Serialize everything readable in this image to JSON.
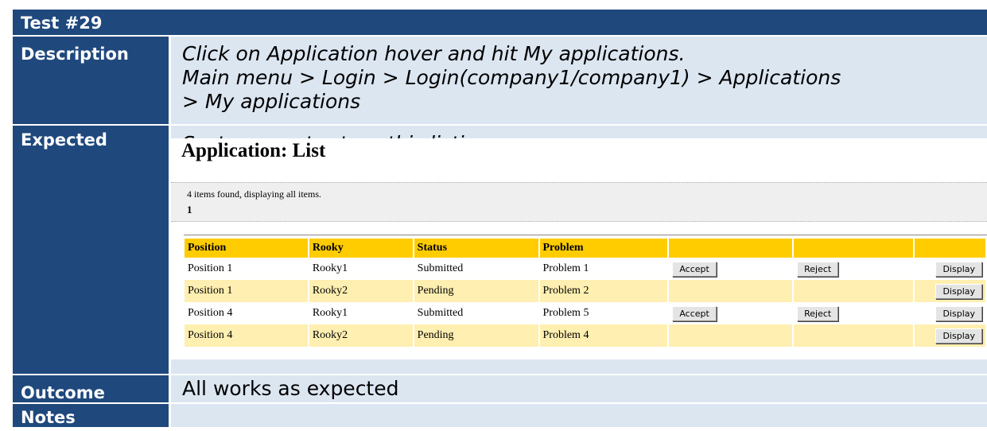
{
  "header": {
    "title": "Test #29"
  },
  "rows": {
    "description": {
      "label": "Description",
      "line1": "Click on Application hover and hit My applications.",
      "line2": "Main menu > Login > Login(company1/company1) > Applications",
      "line3": "> My applications"
    },
    "expected": {
      "label": "Expected",
      "text": "System must return this listing"
    },
    "outcome": {
      "label": "Outcome",
      "text": "All works as expected"
    },
    "notes": {
      "label": "Notes",
      "text": ""
    }
  },
  "app": {
    "title": "Application: List",
    "found_text": "4 items found, displaying all items.",
    "page": "1",
    "columns": [
      "Position",
      "Rooky",
      "Status",
      "Problem",
      "",
      "",
      ""
    ],
    "buttons": {
      "accept": "Accept",
      "reject": "Reject",
      "display": "Display"
    },
    "rows": [
      {
        "position": "Position 1",
        "rooky": "Rooky1",
        "status": "Submitted",
        "problem": "Problem 1"
      },
      {
        "position": "Position 1",
        "rooky": "Rooky2",
        "status": "Pending",
        "problem": "Problem 2"
      },
      {
        "position": "Position 4",
        "rooky": "Rooky1",
        "status": "Submitted",
        "problem": "Problem 5"
      },
      {
        "position": "Position 4",
        "rooky": "Rooky2",
        "status": "Pending",
        "problem": "Problem 4"
      }
    ]
  },
  "colors": {
    "label_bg": "#1f497d",
    "value_bg": "#dce6f1",
    "table_header": "#ffcc00",
    "table_alt_row": "#ffefb0"
  }
}
